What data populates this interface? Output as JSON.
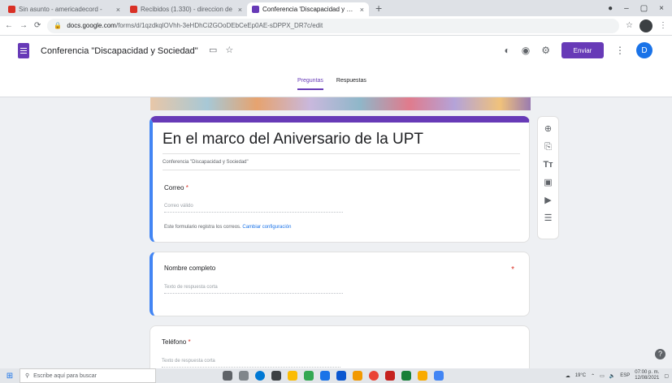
{
  "browser": {
    "tabs": [
      {
        "label": "Sin asunto - americadecord - ",
        "fav": "#d93025",
        "close": "×"
      },
      {
        "label": "Recibidos (1.330) - direccion de",
        "fav": "#d93025",
        "close": "×"
      },
      {
        "label": "Conferencia 'Discapacidad y Soc",
        "fav": "#673ab7",
        "close": "×",
        "active": true
      }
    ],
    "newtab": "+",
    "url_host": "docs.google.com",
    "url_path": "/forms/d/1qzdkqlOVhh-3eHDhCi2GOoDEbCeEp0AE-sDPPX_DR7c/edit",
    "window_controls": [
      "●",
      "–",
      "▢",
      "×"
    ]
  },
  "form_header": {
    "title": "Conferencia \"Discapacidad y Sociedad\"",
    "send_label": "Enviar",
    "avatar": "D",
    "tabs": [
      "Preguntas",
      "Respuestas"
    ]
  },
  "form": {
    "title": "En el marco del Aniversario de la UPT",
    "description": "Conferencia \"Discapacidad y Sociedad\"",
    "email_label": "Correo",
    "required": "*",
    "email_placeholder": "Correo válido",
    "email_note": "Este formulario registra los correos.",
    "email_link": "Cambiar configuración",
    "q1_label": "Nombre completo",
    "q1_placeholder": "Texto de respuesta corta",
    "q2_label": "Teléfono",
    "q2_placeholder": "Texto de respuesta corta"
  },
  "toolbar_icons": [
    "add-question-icon",
    "import-questions-icon",
    "add-title-icon",
    "add-image-icon",
    "add-video-icon",
    "add-section-icon"
  ],
  "taskbar": {
    "search_placeholder": "Escribe aquí para buscar",
    "temperature": "19°C",
    "language": "ESP",
    "time": "07:00 p. m.",
    "date": "12/08/2021"
  }
}
